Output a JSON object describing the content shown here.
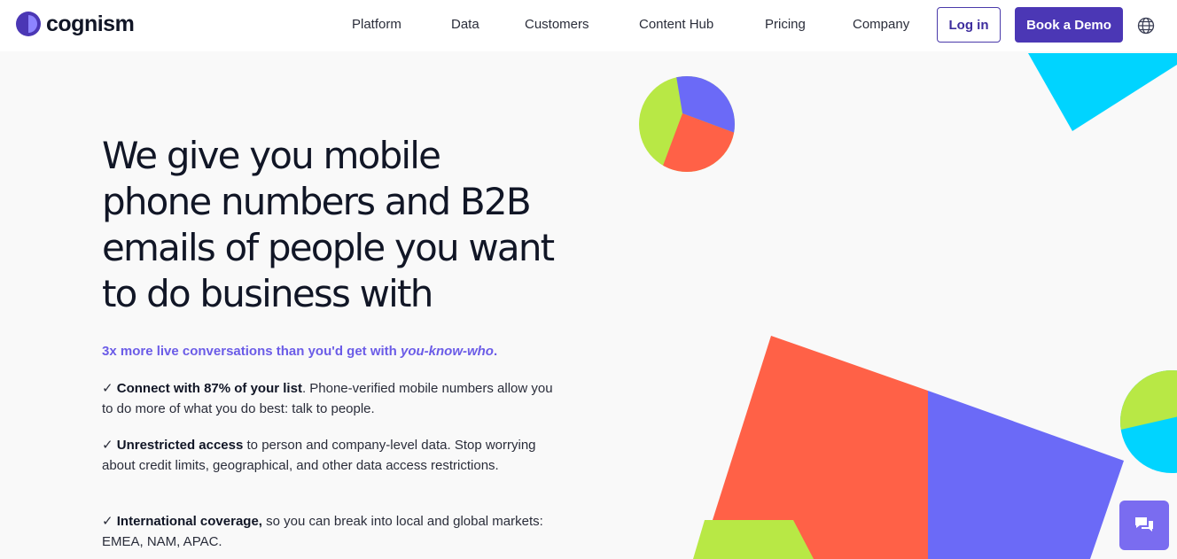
{
  "brand": {
    "name": "cognism"
  },
  "nav": {
    "items": [
      {
        "label": "Platform"
      },
      {
        "label": "Data"
      },
      {
        "label": "Customers"
      },
      {
        "label": "Content Hub"
      },
      {
        "label": "Pricing"
      },
      {
        "label": "Company"
      }
    ],
    "login_label": "Log in",
    "demo_label": "Book a Demo",
    "language_icon": "globe-icon"
  },
  "hero": {
    "headline": [
      "We give you mobile",
      "phone numbers and B2B",
      "emails of people you want",
      "to do business with"
    ],
    "tagline_prefix": "3x more live conversations than you'd get with ",
    "tagline_emphasis": "you-know-who",
    "tagline_suffix": ".",
    "bullets": [
      {
        "mark": "✓ ",
        "bold": "Connect with 87% of your list",
        "text": ". Phone-verified mobile numbers allow you to do more of what you do best: talk to people."
      },
      {
        "mark": "✓ ",
        "bold": "Unrestricted access",
        "text": " to person and company-level data. Stop worrying about credit limits, geographical, and other data access restrictions."
      },
      {
        "mark": "✓ ",
        "bold": "International coverage,",
        "text": " so you can break into local and global markets: EMEA, NAM, APAC."
      }
    ]
  },
  "chat": {
    "icon": "chat-bubbles-icon"
  },
  "colors": {
    "brand_purple": "#4b37b5",
    "accent_violet": "#6b6af7",
    "coral": "#ff6147",
    "lime": "#b8e845",
    "cyan": "#00d4ff"
  }
}
